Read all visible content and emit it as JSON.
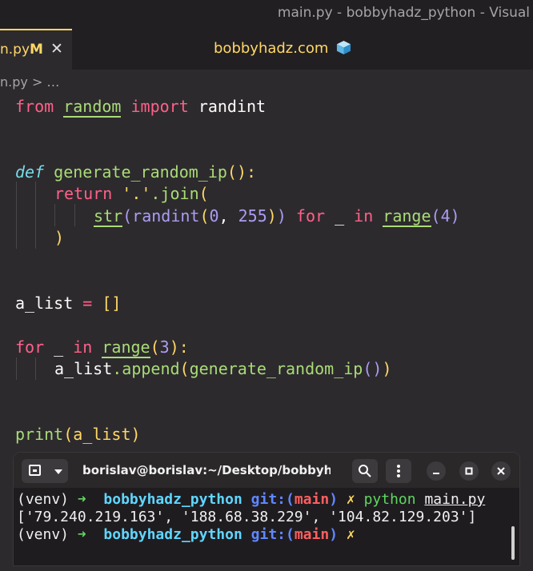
{
  "window": {
    "title": "main.py - bobbyhadz_python - Visual"
  },
  "tab": {
    "name": "n.py",
    "modified": "M",
    "close": "✕"
  },
  "center_label": "bobbyhadz.com",
  "breadcrumb": "n.py > …",
  "code": {
    "l1": [
      "from",
      "random",
      "import",
      "randint"
    ],
    "l2": [
      "def",
      "generate_random_ip",
      "():"
    ],
    "l3": [
      "return",
      "'.'",
      ".join",
      "("
    ],
    "l4": [
      "str",
      "(randint",
      "(",
      "0",
      ", ",
      "255",
      ")",
      ")",
      " for",
      " _ ",
      "in",
      "range",
      "(",
      "4",
      ")"
    ],
    "l5": [
      ")"
    ],
    "l6": [
      "a_list",
      " = ",
      "[]"
    ],
    "l7": [
      "for",
      " _ ",
      "in",
      "range",
      "(",
      "3",
      "):"
    ],
    "l8": [
      "a_list",
      ".append",
      "(",
      "generate_random_ip",
      "()",
      ")"
    ],
    "l9": [
      "print",
      "(a_list",
      ")"
    ]
  },
  "terminal": {
    "title": "borislav@borislav:~/Desktop/bobbyhadz_...",
    "prompt_venv": "(venv)",
    "arrow": "➜",
    "dir": "bobbyhadz_python",
    "git_label": "git:(",
    "branch": "main",
    "git_close": ")",
    "x_mark": "✗",
    "cmd": "python",
    "file": "main.py",
    "output": "['79.240.219.163', '188.68.38.229', '104.82.129.203']"
  },
  "colors": {
    "accent": "#ffd866",
    "editor_bg": "#2d2a2e",
    "keyword": "#ff6188",
    "function": "#a9dc76"
  }
}
